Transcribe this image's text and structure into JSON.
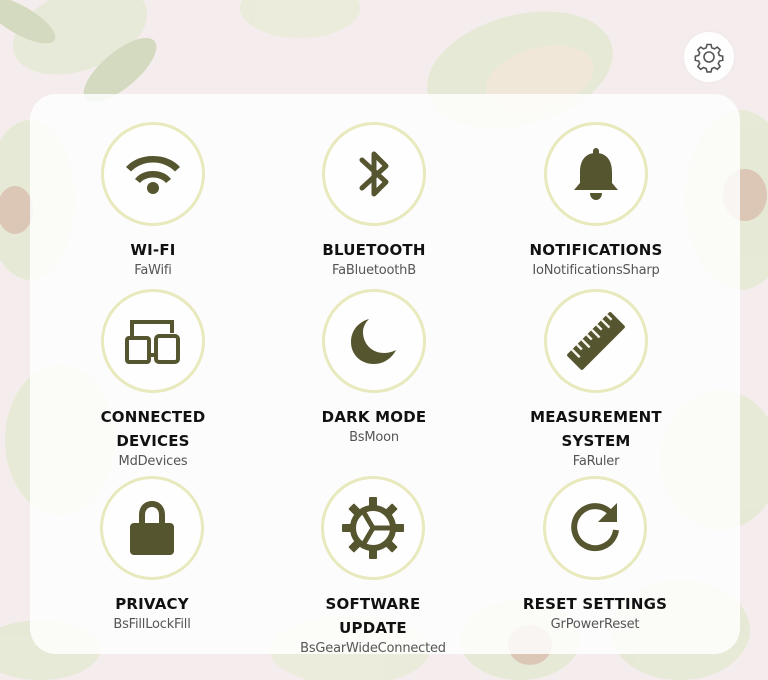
{
  "colors": {
    "icon": "#55552f",
    "ring": "#e8e9bd",
    "label": "#111111",
    "sublabel": "#555555"
  },
  "header": {
    "settings_icon": "gear-outline-icon"
  },
  "tiles": [
    {
      "label": "WI-FI",
      "component": "FaWifi",
      "icon": "wifi-icon"
    },
    {
      "label": "BLUETOOTH",
      "component": "FaBluetoothB",
      "icon": "bluetooth-icon"
    },
    {
      "label": "NOTIFICATIONS",
      "component": "IoNotificationsSharp",
      "icon": "bell-icon"
    },
    {
      "label": "CONNECTED DEVICES",
      "component": "MdDevices",
      "icon": "devices-icon"
    },
    {
      "label": "DARK MODE",
      "component": "BsMoon",
      "icon": "moon-icon"
    },
    {
      "label": "MEASUREMENT SYSTEM",
      "component": "FaRuler",
      "icon": "ruler-icon"
    },
    {
      "label": "PRIVACY",
      "component": "BsFillLockFill",
      "icon": "lock-icon"
    },
    {
      "label": "SOFTWARE UPDATE",
      "component": "BsGearWideConnected",
      "icon": "gear-wide-icon"
    },
    {
      "label": "RESET SETTINGS",
      "component": "GrPowerReset",
      "icon": "reset-icon"
    }
  ]
}
